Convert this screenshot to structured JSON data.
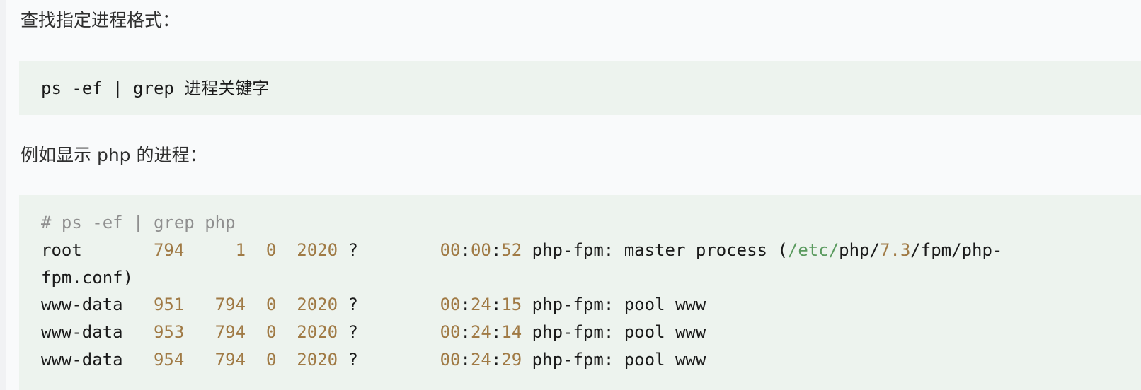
{
  "intro_text": "查找指定进程格式：",
  "command_block": {
    "text": "ps -ef | grep 进程关键字"
  },
  "example_text": "例如显示 php 的进程：",
  "example_block": {
    "comment": "# ps -ef | grep php",
    "rows": [
      {
        "user": "root",
        "pid": "794",
        "ppid": "1",
        "c": "0",
        "stime": "2020",
        "tty": "?",
        "time_h": "00",
        "time_m": "00",
        "time_s": "52",
        "cmd_a": "php-fpm: master process (",
        "cmd_path": "/etc/",
        "cmd_b": "php/",
        "cmd_ver": "7.3",
        "cmd_c": "/fpm/php-",
        "cmd_wrap": "fpm.conf)"
      },
      {
        "user": "www-data",
        "pid": "951",
        "ppid": "794",
        "c": "0",
        "stime": "2020",
        "tty": "?",
        "time_h": "00",
        "time_m": "24",
        "time_s": "15",
        "cmd": "php-fpm: pool www"
      },
      {
        "user": "www-data",
        "pid": "953",
        "ppid": "794",
        "c": "0",
        "stime": "2020",
        "tty": "?",
        "time_h": "00",
        "time_m": "24",
        "time_s": "14",
        "cmd": "php-fpm: pool www"
      },
      {
        "user": "www-data",
        "pid": "954",
        "ppid": "794",
        "c": "0",
        "stime": "2020",
        "tty": "?",
        "time_h": "00",
        "time_m": "24",
        "time_s": "29",
        "cmd": "php-fpm: pool www"
      }
    ]
  },
  "colors": {
    "code_background": "#edf3ee",
    "number_token": "#a07a45",
    "path_token": "#5a9a5e",
    "comment_token": "#8f8f8f"
  }
}
